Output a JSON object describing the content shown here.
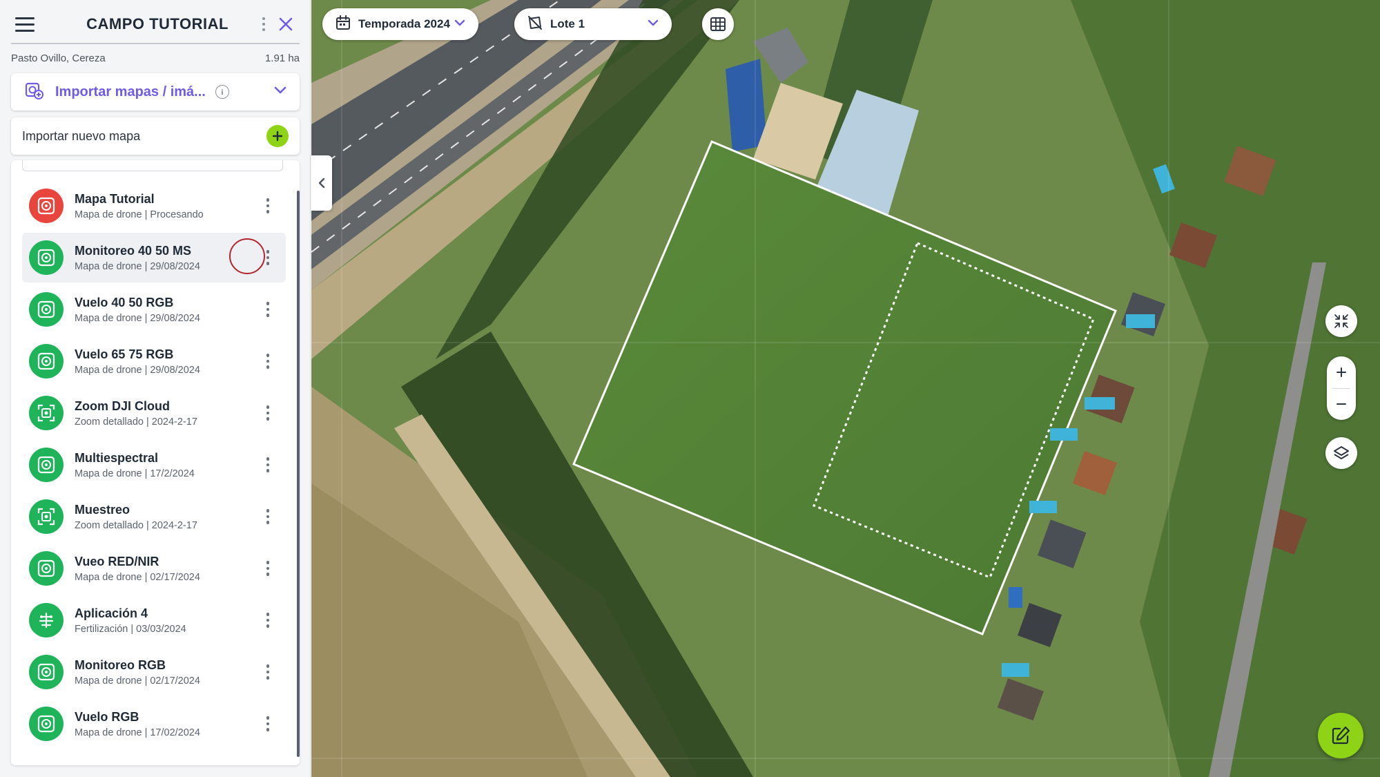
{
  "app": {
    "title": "CAMPO TUTORIAL"
  },
  "field": {
    "crops": "Pasto Ovillo, Cereza",
    "area": "1.91 ha"
  },
  "import": {
    "label": "Importar mapas / imá...",
    "new_map_label": "Importar nuevo mapa"
  },
  "maps": [
    {
      "name": "Mapa Tutorial",
      "subtitle": "Mapa de drone | Procesando",
      "icon": "drone-map-icon",
      "color": "#e8453c",
      "selected": false
    },
    {
      "name": "Monitoreo 40 50 MS",
      "subtitle": "Mapa de drone | 29/08/2024",
      "icon": "drone-map-icon",
      "color": "#1fb45a",
      "selected": true
    },
    {
      "name": "Vuelo 40 50 RGB",
      "subtitle": "Mapa de drone | 29/08/2024",
      "icon": "drone-map-icon",
      "color": "#1fb45a",
      "selected": false
    },
    {
      "name": "Vuelo 65 75 RGB",
      "subtitle": "Mapa de drone | 29/08/2024",
      "icon": "drone-map-icon",
      "color": "#1fb45a",
      "selected": false
    },
    {
      "name": "Zoom DJI Cloud",
      "subtitle": "Zoom detallado | 2024-2-17",
      "icon": "zoom-detail-icon",
      "color": "#1fb45a",
      "selected": false
    },
    {
      "name": "Multiespectral",
      "subtitle": "Mapa de drone | 17/2/2024",
      "icon": "drone-map-icon",
      "color": "#1fb45a",
      "selected": false
    },
    {
      "name": "Muestreo",
      "subtitle": "Zoom detallado | 2024-2-17",
      "icon": "zoom-detail-icon",
      "color": "#1fb45a",
      "selected": false
    },
    {
      "name": "Vueo RED/NIR",
      "subtitle": "Mapa de drone | 02/17/2024",
      "icon": "drone-map-icon",
      "color": "#1fb45a",
      "selected": false
    },
    {
      "name": "Aplicación 4",
      "subtitle": "Fertilización | 03/03/2024",
      "icon": "fertilization-icon",
      "color": "#1fb45a",
      "selected": false
    },
    {
      "name": "Monitoreo RGB",
      "subtitle": "Mapa de drone | 02/17/2024",
      "icon": "drone-map-icon",
      "color": "#1fb45a",
      "selected": false
    },
    {
      "name": "Vuelo RGB",
      "subtitle": "Mapa de drone | 17/02/2024",
      "icon": "drone-map-icon",
      "color": "#1fb45a",
      "selected": false
    }
  ],
  "toolbar": {
    "season": "Temporada 2024",
    "lot": "Lote 1"
  },
  "colors": {
    "accent_purple": "#6c5ce7",
    "accent_green": "#8fd317",
    "item_green": "#1fb45a",
    "item_red": "#e8453c"
  }
}
